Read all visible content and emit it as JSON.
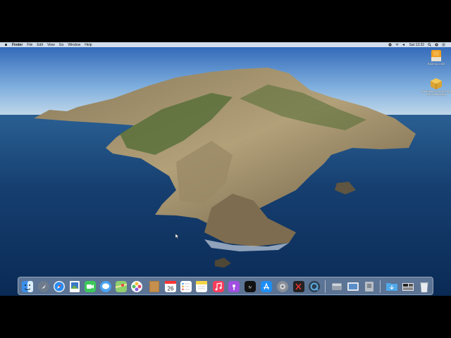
{
  "menubar": {
    "apple_icon": "apple-icon",
    "items": [
      "Finder",
      "File",
      "Edit",
      "View",
      "Go",
      "Window",
      "Help"
    ],
    "clock": "Sat 13:32",
    "status_icons": [
      "screen-record-icon",
      "wifi-icon",
      "volume-icon",
      "search-icon",
      "control-center-icon",
      "menu-list-icon"
    ]
  },
  "desktop": {
    "items": [
      {
        "label": "RADIKAL.COM",
        "icon": "radikal-app-icon"
      },
      {
        "label": "Install macOS 10.15.2 (Big Sur) Catalina.pkg",
        "icon": "package-icon"
      }
    ]
  },
  "dock": {
    "apps": [
      "finder",
      "launchpad",
      "safari",
      "preview",
      "facetime",
      "messages",
      "maps",
      "photos",
      "notes-book",
      "calendar",
      "reminders",
      "notes",
      "music",
      "podcasts",
      "apple-tv",
      "app-store",
      "system-preferences",
      "terminal-util",
      "quicktime",
      "disk-utility",
      "photo-library",
      "archive-utility"
    ],
    "calendar_date": "26",
    "right_items": [
      "downloads-folder",
      "screenshot-stack",
      "trash"
    ]
  },
  "colors": {
    "sky_top": "#2f68b8",
    "ocean": "#123d6e",
    "menubar_bg": "#e1e8f0",
    "dock_bg": "#becde1"
  }
}
